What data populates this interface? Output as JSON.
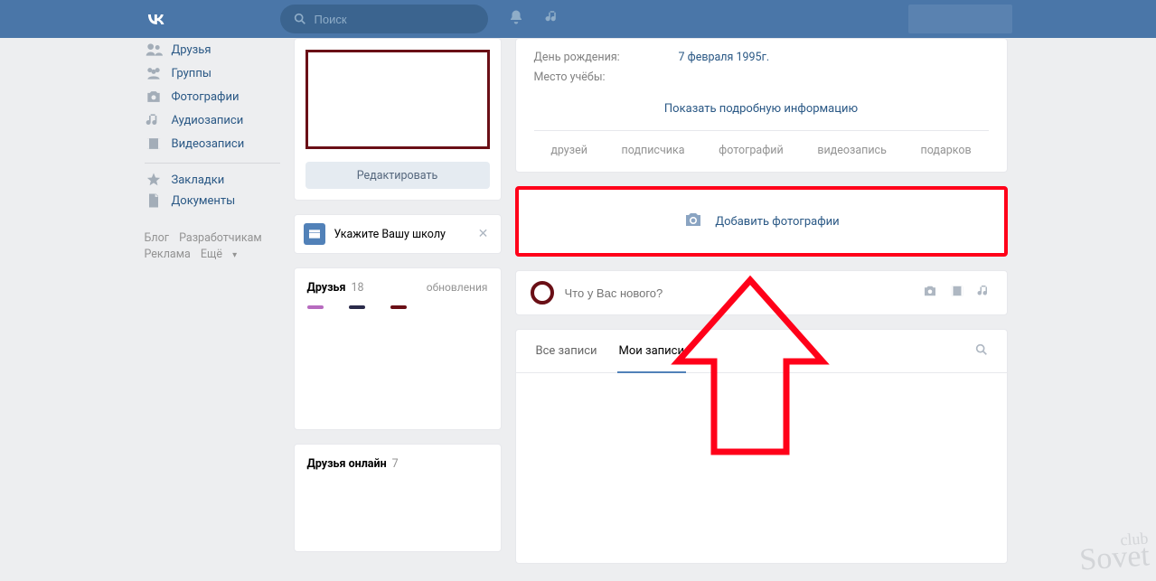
{
  "topbar": {
    "search_placeholder": "Поиск"
  },
  "nav": {
    "items": [
      {
        "label": "Друзья",
        "icon": "friends"
      },
      {
        "label": "Группы",
        "icon": "groups"
      },
      {
        "label": "Фотографии",
        "icon": "photo"
      },
      {
        "label": "Аудиозаписи",
        "icon": "audio"
      },
      {
        "label": "Видеозаписи",
        "icon": "video"
      }
    ],
    "items2": [
      {
        "label": "Закладки",
        "icon": "star"
      },
      {
        "label": "Документы",
        "icon": "doc"
      }
    ]
  },
  "footer": {
    "blog": "Блог",
    "dev": "Разработчикам",
    "ads": "Реклама",
    "more": "Ещё"
  },
  "profile": {
    "edit_label": "Редактировать",
    "school_prompt": "Укажите Вашу школу"
  },
  "friends": {
    "title": "Друзья",
    "count": "18",
    "updates": "обновления",
    "online_title": "Друзья онлайн",
    "online_count": "7"
  },
  "info": {
    "birthday_label": "День рождения:",
    "birthday_value": "7 февраля 1995г.",
    "study_label": "Место учёбы:",
    "show_more": "Показать подробную информацию",
    "counters": [
      "друзей",
      "подписчика",
      "фотографий",
      "видеозапись",
      "подарков"
    ]
  },
  "photos": {
    "add_label": "Добавить фотографии"
  },
  "post": {
    "placeholder": "Что у Вас нового?"
  },
  "wall": {
    "tab_all": "Все записи",
    "tab_mine": "Мои записи"
  },
  "watermark": {
    "small": "club",
    "big": "Sovet"
  }
}
